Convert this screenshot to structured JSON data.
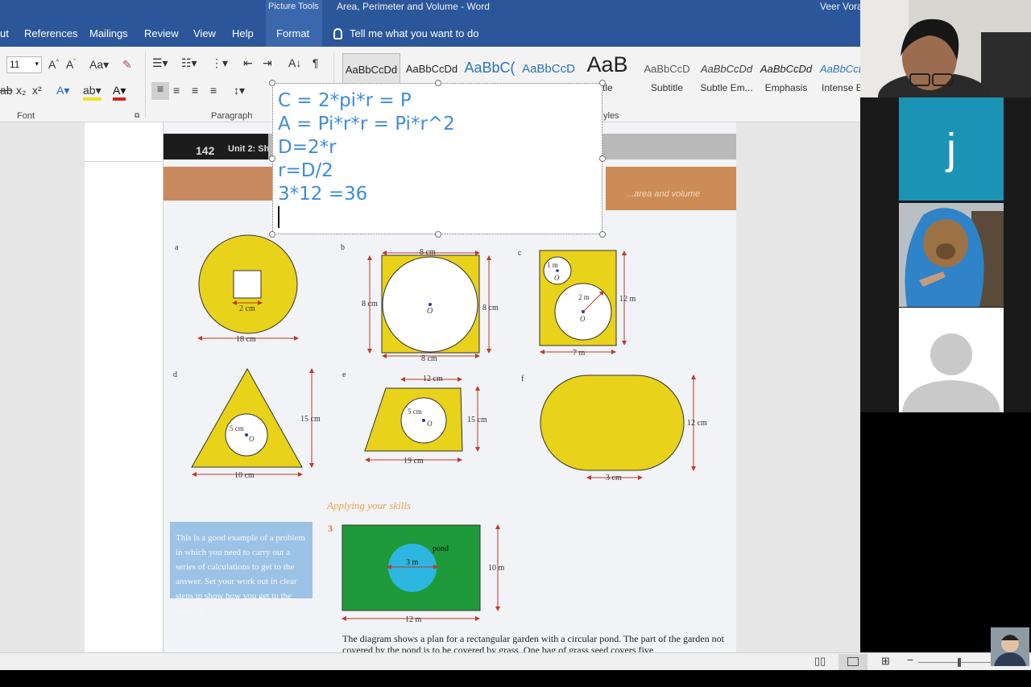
{
  "window": {
    "contextual_tab_group": "Picture Tools",
    "title": "Area, Perimeter and Volume  -  Word",
    "user": "Veer Vora"
  },
  "tabs": [
    "ut",
    "References",
    "Mailings",
    "Review",
    "View",
    "Help",
    "Format"
  ],
  "tell_me": "Tell me what you want to do",
  "ribbon": {
    "font_size": "11",
    "font_group_label": "Font",
    "paragraph_group_label": "Paragraph",
    "styles_group_label": "yles",
    "styles": [
      {
        "sample": "AaBbCcDd",
        "name": ""
      },
      {
        "sample": "AaBbCcDd",
        "name": ""
      },
      {
        "sample": "AaBbC(",
        "name": ""
      },
      {
        "sample": "AaBbCcD",
        "name": ""
      },
      {
        "sample": "AaB",
        "name": "tle"
      },
      {
        "sample": "AaBbCcD",
        "name": "Subtitle"
      },
      {
        "sample": "AaBbCcDd",
        "name": "Subtle Em..."
      },
      {
        "sample": "AaBbCcDd",
        "name": "Emphasis"
      },
      {
        "sample": "AaBbCcDd",
        "name": "Intense E"
      }
    ]
  },
  "textbox": {
    "lines": [
      "C = 2*pi*r = P",
      "A = Pi*r*r = Pi*r^2",
      "D=2*r",
      "r=D/2",
      "3*12 =36"
    ]
  },
  "page": {
    "page_number": "142",
    "unit": "Unit 2: Sh",
    "section_banner": "...area and volume",
    "labels": {
      "a": "a",
      "b": "b",
      "c": "c",
      "d": "d",
      "e": "e",
      "f": "f",
      "a_square": "2 cm",
      "a_width": "18 cm",
      "b_top": "8 cm",
      "b_left": "8 cm",
      "b_right": "8 cm",
      "b_bottom": "8 cm",
      "b_center": "O",
      "c_small": "1 m",
      "c_big": "2 m",
      "c_right": "12 m",
      "c_bottom": "7 m",
      "c_center": "O",
      "d_height": "15 cm",
      "d_base": "10 cm",
      "d_radius": "5 cm",
      "d_center": "O",
      "e_top": "12 cm",
      "e_height": "15 cm",
      "e_base": "19 cm",
      "e_radius": "5 cm",
      "e_center": "O",
      "f_height": "12 cm",
      "f_width": "3 cm",
      "pond": "pond",
      "pond_diameter": "3 m",
      "garden_height": "10 m",
      "garden_width": "12 m"
    },
    "tip": "This is a good example of a problem in which you need to carry out a series of calculations to get to the answer. Set your work out in clear steps to show how you get to the solution.",
    "applying_heading": "Applying your skills",
    "question_number": "3",
    "question_text": "The diagram shows a plan for a rectangular garden with a circular pond. The part of the garden not covered by the pond is to be covered by grass. One bag of grass seed covers five"
  },
  "participants": [
    {
      "type": "camera",
      "name": "presenter"
    },
    {
      "type": "letter",
      "initial": "j"
    },
    {
      "type": "camera",
      "name": "dog"
    },
    {
      "type": "placeholder"
    }
  ],
  "colors": {
    "word_blue": "#2b579a",
    "shape_yellow": "#e8d21a",
    "garden_green": "#1f9a3a",
    "pond_blue": "#2db6e0",
    "formula_blue": "#3f8cd8",
    "tile_teal": "#1b93b4"
  }
}
